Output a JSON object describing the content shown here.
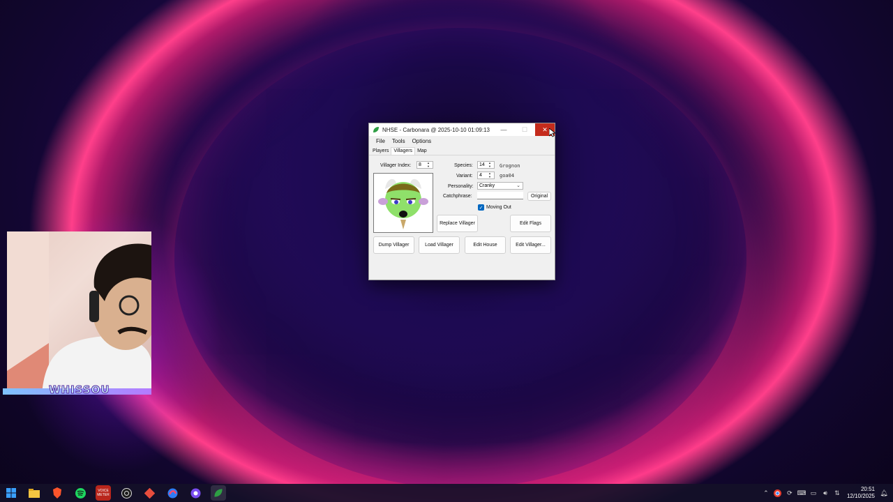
{
  "window": {
    "title": "NHSE - Carbonara @ 2025-10-10 01:09:13",
    "minimize_glyph": "—",
    "maximize_glyph": "☐",
    "close_glyph": "✕"
  },
  "menu": [
    "File",
    "Tools",
    "Options"
  ],
  "tabs": [
    "Players",
    "Villagers",
    "Map"
  ],
  "active_tab": "Villagers",
  "villager": {
    "index_label": "Villager Index:",
    "index_value": "8",
    "species_label": "Species:",
    "species_value": "14",
    "species_name": "Grognon",
    "variant_label": "Variant:",
    "variant_value": "4",
    "variant_code": "goa04",
    "personality_label": "Personality:",
    "personality_value": "Cranky",
    "catchphrase_label": "Catchphrase:",
    "catchphrase_value": "",
    "original_button": "Original",
    "moving_out_label": "Moving Out",
    "moving_out_checked": true
  },
  "buttons": {
    "replace": "Replace Villager",
    "edit_flags": "Edit Flags",
    "dump": "Dump Villager",
    "load": "Load Villager",
    "edit_house": "Edit House",
    "edit_villager": "Edit Villager..."
  },
  "webcam": {
    "logo_text": "WHISSOU"
  },
  "taskbar": {
    "apps": [
      "start-icon",
      "file-explorer-icon",
      "brave-icon",
      "spotify-icon",
      "voicemeeter-icon",
      "obs-icon",
      "git-icon",
      "app-icon",
      "app-icon-2",
      "nhse-icon"
    ],
    "voicemeeter_text": "VOICE METER",
    "time": "20:51",
    "date": "12/10/2025"
  },
  "colors": {
    "close_button": "#c42b1c",
    "checkbox": "#0067c0",
    "accent": "#ff3f8a"
  }
}
